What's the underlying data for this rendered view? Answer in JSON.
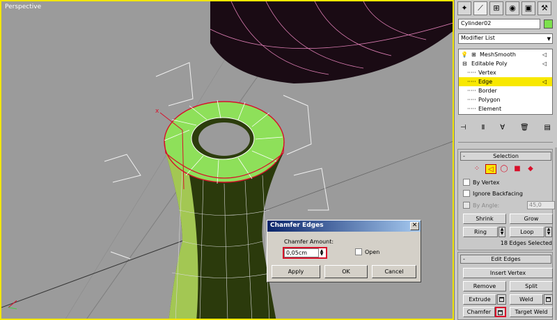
{
  "viewport": {
    "label": "Perspective"
  },
  "dialog": {
    "title": "Chamfer Edges",
    "close_glyph": "✕",
    "amount_label": "Chamfer Amount:",
    "amount_value": "0,05cm",
    "open_label": "Open",
    "apply_label": "Apply",
    "ok_label": "OK",
    "cancel_label": "Cancel"
  },
  "panel": {
    "tabs": [
      "create-icon",
      "modify-icon",
      "hierarchy-icon",
      "motion-icon",
      "display-icon",
      "utilities-icon"
    ],
    "object_name": "Cylinder02",
    "object_color": "#7de14d",
    "modifier_list": "Modifier List",
    "stack": [
      {
        "label": "MeshSmooth"
      },
      {
        "label": "Editable Poly"
      },
      {
        "label": "Vertex"
      },
      {
        "label": "Edge"
      },
      {
        "label": "Border"
      },
      {
        "label": "Polygon"
      },
      {
        "label": "Element"
      }
    ],
    "selection": {
      "title": "Selection",
      "by_vertex": "By Vertex",
      "ignore_backfacing": "Ignore Backfacing",
      "by_angle": "By Angle:",
      "angle_value": "45,0",
      "shrink": "Shrink",
      "grow": "Grow",
      "ring": "Ring",
      "loop": "Loop",
      "status": "18 Edges Selected"
    },
    "edit_edges": {
      "title": "Edit Edges",
      "insert_vertex": "Insert Vertex",
      "remove": "Remove",
      "split": "Split",
      "extrude": "Extrude",
      "weld": "Weld",
      "chamfer": "Chamfer",
      "target_weld": "Target Weld"
    },
    "rollout_glyph": "-"
  },
  "colors": {
    "accent": "#f8e800",
    "highlight": "#d8102a",
    "mesh_green": "#8ee05a"
  }
}
